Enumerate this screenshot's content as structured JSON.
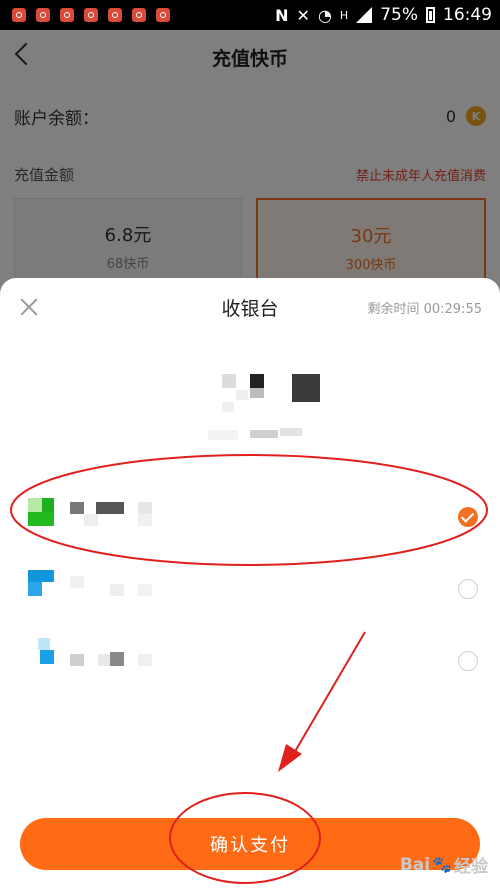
{
  "status_bar": {
    "battery": "75%",
    "time": "16:49",
    "network_letter": "N",
    "h_label": "H"
  },
  "page": {
    "title": "充值快币",
    "balance_label": "账户余额：",
    "balance_value": "0",
    "coin_symbol": "K",
    "amount_label": "充值金额",
    "minor_notice": "禁止未成年人充值消费",
    "options": [
      {
        "price": "6.8元",
        "coins": "68快币"
      },
      {
        "price": "30元",
        "coins": "300快币",
        "selected": true
      }
    ]
  },
  "sheet": {
    "title": "收银台",
    "countdown": "剩余时间 00:29:55",
    "confirm_label": "确认支付",
    "payment_methods": [
      {
        "selected": true
      },
      {
        "selected": false
      },
      {
        "selected": false
      }
    ]
  },
  "watermark": {
    "text_a": "Bai",
    "text_b": "经验",
    "paw": "🐾"
  },
  "colors": {
    "accent": "#ff6a14",
    "annotation": "#e0201c",
    "alert": "#e8402a"
  }
}
